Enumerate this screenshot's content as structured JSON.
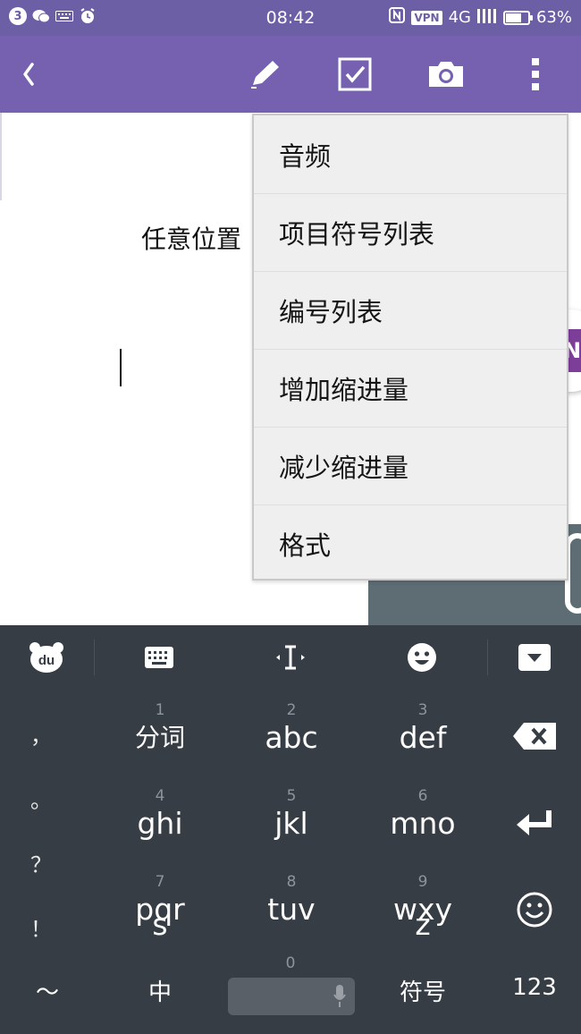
{
  "status_bar": {
    "notification_count": "3",
    "time": "08:42",
    "vpn_label": "VPN",
    "network": "4G",
    "battery_percent": "63%",
    "battery_level": 0.63
  },
  "toolbar": {
    "icons": [
      "back-icon",
      "pencil-icon",
      "checkbox-icon",
      "camera-icon",
      "more-vertical-icon"
    ]
  },
  "note": {
    "text": "任意位置"
  },
  "menu": {
    "items": [
      "音频",
      "项目符号列表",
      "编号列表",
      "增加缩进量",
      "减少缩进量",
      "格式"
    ]
  },
  "onenote": {
    "logo_letter": "N"
  },
  "keyboard": {
    "top_bar_icons": [
      "du-logo-icon",
      "keyboard-icon",
      "cursor-icon",
      "emoji-face-icon",
      "hide-keyboard-icon"
    ],
    "du_logo_text": "du",
    "punctuation": [
      "，",
      "。",
      "？",
      "！"
    ],
    "keys": [
      {
        "num": "1",
        "label": "分词"
      },
      {
        "num": "2",
        "label": "abc"
      },
      {
        "num": "3",
        "label": "def"
      },
      {
        "num": "4",
        "label": "ghi"
      },
      {
        "num": "5",
        "label": "jkl"
      },
      {
        "num": "6",
        "label": "mno"
      },
      {
        "num": "7",
        "label": "pqr",
        "sub": "s"
      },
      {
        "num": "8",
        "label": "tuv"
      },
      {
        "num": "9",
        "label": "wxy",
        "sub": "z"
      }
    ],
    "bottom": {
      "tilde": "～",
      "lang": "中",
      "zero": "0",
      "symbols": "符号",
      "numbers": "123"
    },
    "right_icons": [
      "backspace-icon",
      "enter-icon",
      "smiley-icon"
    ]
  },
  "colors": {
    "status_bar": "#6d5fa5",
    "toolbar": "#7561b0",
    "menu_bg": "#efefef",
    "keyboard_bg": "#363d45",
    "onenote_purple": "#7d3e9a"
  }
}
